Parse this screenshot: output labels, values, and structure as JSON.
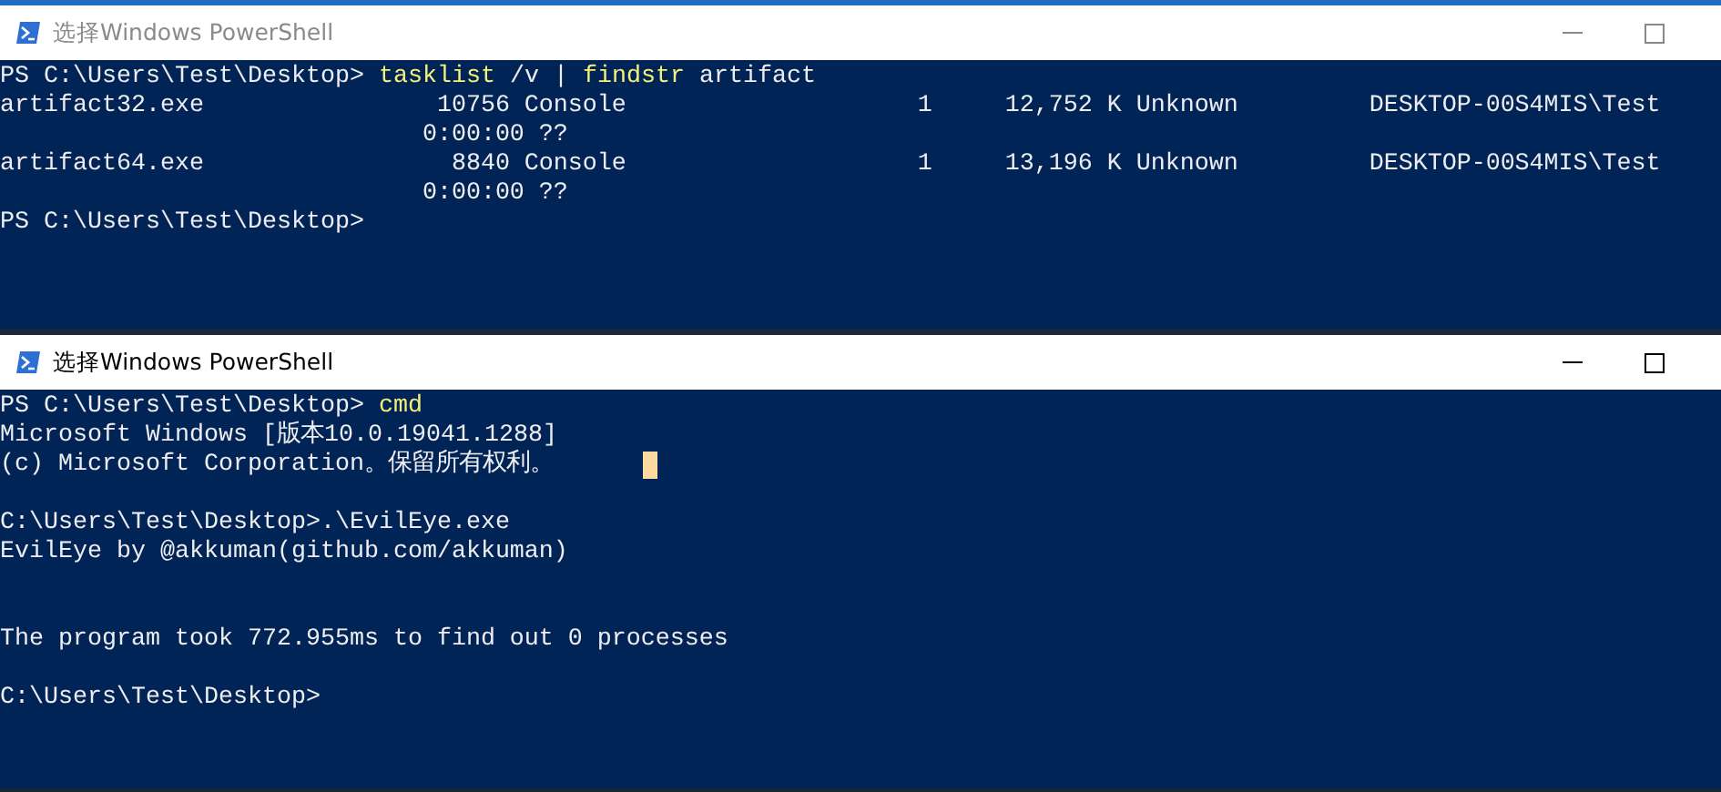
{
  "windows": [
    {
      "title": "选择Windows PowerShell",
      "active": false,
      "lines": [
        {
          "kind": "prompt",
          "prompt": "PS C:\\Users\\Test\\Desktop> ",
          "command": "tasklist",
          "args": " /v | ",
          "command2": "findstr",
          "args2": " artifact"
        },
        {
          "kind": "output",
          "text": "artifact32.exe                10756 Console                    1     12,752 K Unknown         DESKTOP-00S4MIS\\Test"
        },
        {
          "kind": "output",
          "text": "                             0:00:00 ??"
        },
        {
          "kind": "output",
          "text": "artifact64.exe                 8840 Console                    1     13,196 K Unknown         DESKTOP-00S4MIS\\Test"
        },
        {
          "kind": "output",
          "text": "                             0:00:00 ??"
        },
        {
          "kind": "prompt",
          "prompt": "PS C:\\Users\\Test\\Desktop>"
        }
      ]
    },
    {
      "title": "选择Windows PowerShell",
      "active": true,
      "lines": [
        {
          "kind": "prompt",
          "prompt": "PS C:\\Users\\Test\\Desktop> ",
          "command": "cmd"
        },
        {
          "kind": "output",
          "text": "Microsoft Windows [版本10.0.19041.1288]"
        },
        {
          "kind": "output",
          "text": "(c) Microsoft Corporation。保留所有权利。",
          "cursor": true
        },
        {
          "kind": "blank"
        },
        {
          "kind": "output",
          "text": "C:\\Users\\Test\\Desktop>.\\EvilEye.exe"
        },
        {
          "kind": "output",
          "text": "EvilEye by @akkuman(github.com/akkuman)"
        },
        {
          "kind": "blank"
        },
        {
          "kind": "blank"
        },
        {
          "kind": "output",
          "text": "The program took 772.955ms to find out 0 processes"
        },
        {
          "kind": "blank"
        },
        {
          "kind": "output",
          "text": "C:\\Users\\Test\\Desktop>"
        }
      ]
    }
  ]
}
